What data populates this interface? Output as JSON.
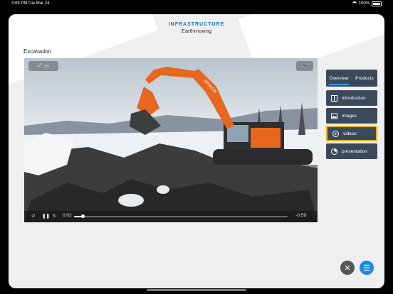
{
  "status_bar": {
    "time": "3:09 PM",
    "date": "Tue Mar 24",
    "battery": "100%"
  },
  "header": {
    "title": "INFRASTRUCTURE",
    "subtitle": "Earthmoving"
  },
  "section_label": "Excavation",
  "video": {
    "elapsed": "0:02",
    "remaining": "-0:59",
    "progress": 0.04,
    "brand_on_machine": "HITACHI"
  },
  "tabs": [
    {
      "label": "Overview",
      "active": true
    },
    {
      "label": "Products",
      "active": false
    }
  ],
  "menu": [
    {
      "label": "introduction",
      "icon": "book-icon",
      "active": false
    },
    {
      "label": "images",
      "icon": "image-icon",
      "active": false
    },
    {
      "label": "videos",
      "icon": "play-icon",
      "active": true
    },
    {
      "label": "presentation",
      "icon": "presentation-icon",
      "active": false
    }
  ],
  "colors": {
    "accent": "#1a73c7",
    "menu_bg": "#3a4a5a",
    "active_border": "#f0b400",
    "close_btn": "#555555",
    "menu_btn": "#1e88e5"
  }
}
